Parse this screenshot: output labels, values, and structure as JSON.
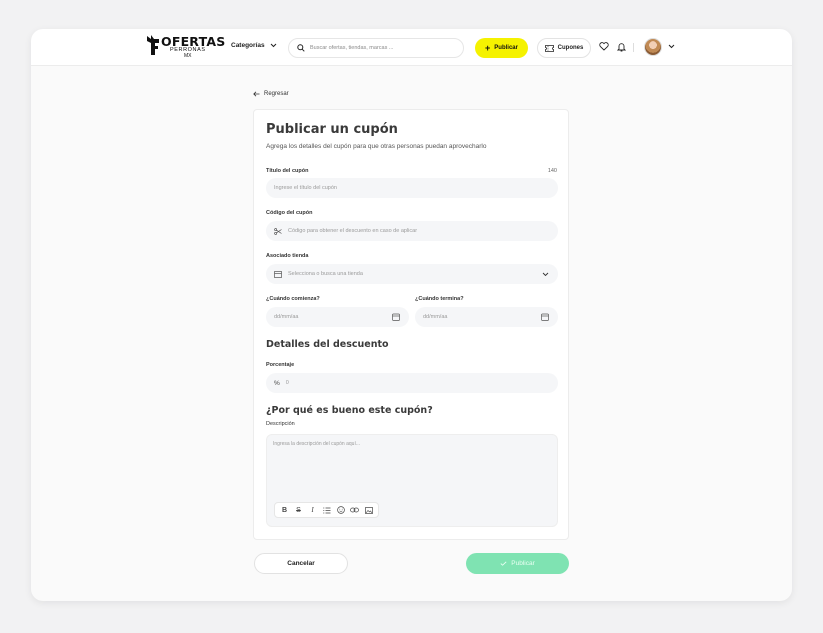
{
  "header": {
    "logo_main": "OFERTAS",
    "logo_sub": "PERRONAS",
    "logo_mx": "MX",
    "categories_label": "Categorías",
    "search_placeholder": "Buscar ofertas, tiendas, marcas ...",
    "publish_label": "Publicar",
    "coupons_label": "Cupones"
  },
  "back_label": "Regresar",
  "form": {
    "title": "Publicar un cupón",
    "subtitle": "Agrega los detalles del cupón para que otras personas puedan aprovecharlo",
    "coupon_title": {
      "label": "Título del cupón",
      "counter": "140",
      "placeholder": "Ingrese el título del cupón"
    },
    "coupon_code": {
      "label": "Código del cupón",
      "placeholder": "Código para obtener el descuento en caso de aplicar"
    },
    "store": {
      "label": "Asociado tienda",
      "placeholder": "Selecciona o busca una tienda"
    },
    "start": {
      "label": "¿Cuándo comienza?",
      "placeholder": "dd/mm/aa"
    },
    "end": {
      "label": "¿Cuándo termina?",
      "placeholder": "dd/mm/aa"
    },
    "discount_section": "Detalles del descuento",
    "percentage": {
      "label": "Porcentaje",
      "prefix": "%",
      "value": "0"
    },
    "why_section": "¿Por qué es bueno este cupón?",
    "description": {
      "label": "Descripción",
      "placeholder": "Ingresa la descripción del cupón aquí..."
    },
    "toolbar": [
      "B",
      "S",
      "I",
      "list",
      "emoji",
      "link",
      "image"
    ]
  },
  "actions": {
    "cancel_label": "Cancelar",
    "submit_label": "Publicar"
  },
  "colors": {
    "accent_yellow": "#f5f200",
    "submit_green": "#7fe3b2",
    "field_bg": "#f5f6f8"
  }
}
